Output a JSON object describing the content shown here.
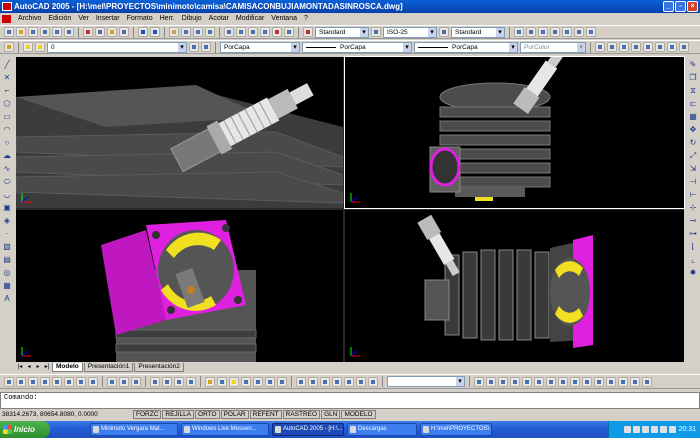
{
  "window": {
    "title": "AutoCAD 2005 - [H:\\mel\\PROYECTOS\\minimoto\\camisa\\CAMISACONBUJIAMONTADASINROSCA.dwg]"
  },
  "menu": [
    "Archivo",
    "Edición",
    "Ver",
    "Insertar",
    "Formato",
    "Herr.",
    "Dibujo",
    "Acotar",
    "Modificar",
    "Ventana",
    "?"
  ],
  "toolbar1": {
    "textstyle": "Standard",
    "dimstyle": "ISO-25",
    "tablestyle": "Standard"
  },
  "toolbar2": {
    "layer": "0",
    "color": "PorCapa",
    "linetype": "PorCapa",
    "lineweight": "PorCapa",
    "plotstyle": "PorColor"
  },
  "layout_tabs": [
    "Modelo",
    "Presentación1",
    "Presentación2"
  ],
  "command": {
    "prompt": "Comando:"
  },
  "status": {
    "coords": "38314.2673, 80654.8080, 0.0000",
    "buttons": [
      "FORZC",
      "REJILLA",
      "ORTO",
      "POLAR",
      "REFENT",
      "RASTREO",
      "GLN",
      "MODELO"
    ]
  },
  "taskbar": {
    "start": "Inicio",
    "items": [
      "Minimoto Vergara Mat...",
      "Windows Live Messen...",
      "AutoCAD 2005 - [H:\\...",
      "Descargas",
      "H:\\mel\\PROYECTOS\\..."
    ],
    "clock": "20:31"
  },
  "colors": {
    "magenta": "#e020e0",
    "yellow": "#f0e020",
    "metal": "#8a8a8a",
    "plug": "#d8d8d8",
    "bg": "#000000"
  }
}
